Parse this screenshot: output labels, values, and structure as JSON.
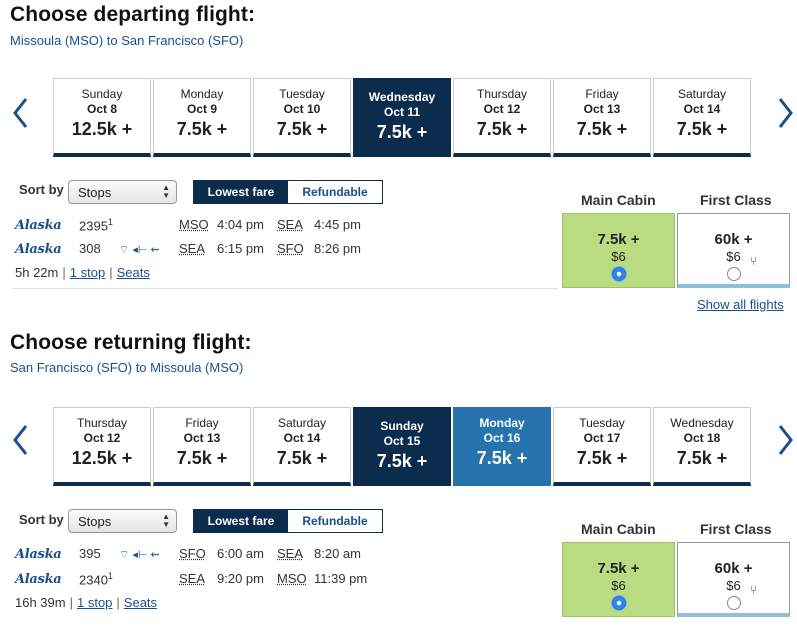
{
  "departing": {
    "title": "Choose departing flight:",
    "route": "Missoula (MSO) to San Francisco (SFO)",
    "dates": [
      {
        "day": "Sunday",
        "date": "Oct 8",
        "points": "12.5k +"
      },
      {
        "day": "Monday",
        "date": "Oct 9",
        "points": "7.5k +"
      },
      {
        "day": "Tuesday",
        "date": "Oct 10",
        "points": "7.5k +"
      },
      {
        "day": "Wednesday",
        "date": "Oct 11",
        "points": "7.5k +",
        "state": "selected"
      },
      {
        "day": "Thursday",
        "date": "Oct 12",
        "points": "7.5k +"
      },
      {
        "day": "Friday",
        "date": "Oct 13",
        "points": "7.5k +"
      },
      {
        "day": "Saturday",
        "date": "Oct 14",
        "points": "7.5k +"
      }
    ],
    "sort_label": "Sort by",
    "sort_value": "Stops",
    "toggle_lowest": "Lowest fare",
    "toggle_refundable": "Refundable",
    "cabin_main": "Main Cabin",
    "cabin_first": "First Class",
    "legs": [
      {
        "airline": "Alaska",
        "flight": "2395",
        "note": "1",
        "from": "MSO",
        "dep": "4:04 pm",
        "to": "SEA",
        "arr": "4:45 pm"
      },
      {
        "airline": "Alaska",
        "flight": "308",
        "note": "",
        "from": "SEA",
        "dep": "6:15 pm",
        "to": "SFO",
        "arr": "8:26 pm"
      }
    ],
    "duration": "5h 22m",
    "stops": "1 stop",
    "seats": "Seats",
    "main_fare": {
      "points": "7.5k +",
      "usd": "$6"
    },
    "first_fare": {
      "points": "60k +",
      "usd": "$6"
    },
    "show_all": "Show all flights"
  },
  "returning": {
    "title": "Choose returning flight:",
    "route": "San Francisco (SFO) to Missoula (MSO)",
    "dates": [
      {
        "day": "Thursday",
        "date": "Oct 12",
        "points": "12.5k +"
      },
      {
        "day": "Friday",
        "date": "Oct 13",
        "points": "7.5k +"
      },
      {
        "day": "Saturday",
        "date": "Oct 14",
        "points": "7.5k +"
      },
      {
        "day": "Sunday",
        "date": "Oct 15",
        "points": "7.5k +",
        "state": "selected"
      },
      {
        "day": "Monday",
        "date": "Oct 16",
        "points": "7.5k +",
        "state": "hover"
      },
      {
        "day": "Tuesday",
        "date": "Oct 17",
        "points": "7.5k +"
      },
      {
        "day": "Wednesday",
        "date": "Oct 18",
        "points": "7.5k +"
      }
    ],
    "sort_label": "Sort by",
    "sort_value": "Stops",
    "toggle_lowest": "Lowest fare",
    "toggle_refundable": "Refundable",
    "cabin_main": "Main Cabin",
    "cabin_first": "First Class",
    "legs": [
      {
        "airline": "Alaska",
        "flight": "395",
        "note": "",
        "from": "SFO",
        "dep": "6:00 am",
        "to": "SEA",
        "arr": "8:20 am"
      },
      {
        "airline": "Alaska",
        "flight": "2340",
        "note": "1",
        "from": "SEA",
        "dep": "9:20 pm",
        "to": "MSO",
        "arr": "11:39 pm"
      }
    ],
    "duration": "16h 39m",
    "stops": "1 stop",
    "seats": "Seats",
    "main_fare": {
      "points": "7.5k +",
      "usd": "$6"
    },
    "first_fare": {
      "points": "60k +",
      "usd": "$6"
    }
  },
  "icons": [
    "chevron-left-icon",
    "chevron-right-icon",
    "wifi-icon",
    "power-icon",
    "usb-icon",
    "seat-icon"
  ],
  "colors": {
    "navy": "#0c2c4e",
    "blue": "#2673ae",
    "link": "#1a4f8a",
    "fare_green": "#b9dc83"
  }
}
